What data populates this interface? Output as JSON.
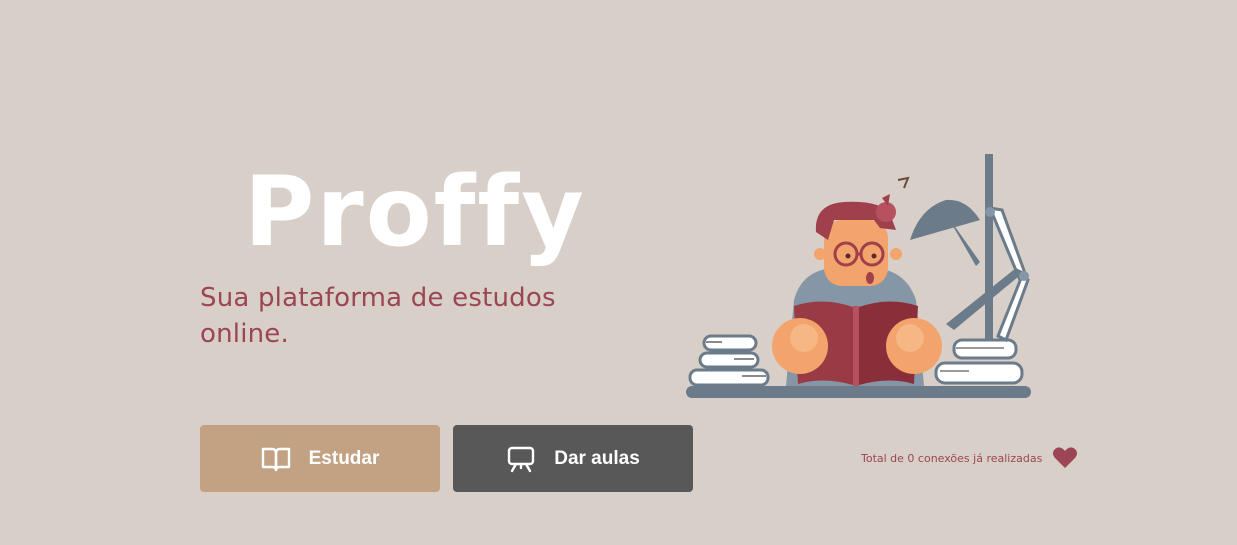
{
  "brand": {
    "name": "Proffy",
    "tagline": "Sua plataforma de estudos online."
  },
  "actions": {
    "study_label": "Estudar",
    "teach_label": "Dar aulas"
  },
  "stats": {
    "connections_text": "Total de 0 conexões já realizadas"
  },
  "icons": {
    "study": "book-open-icon",
    "teach": "presentation-board-icon",
    "heart": "heart-icon"
  },
  "colors": {
    "background": "#d8cfc9",
    "accent": "#9c4556",
    "study_button": "#c3a284",
    "teach_button": "#585858",
    "logo": "#ffffff"
  }
}
